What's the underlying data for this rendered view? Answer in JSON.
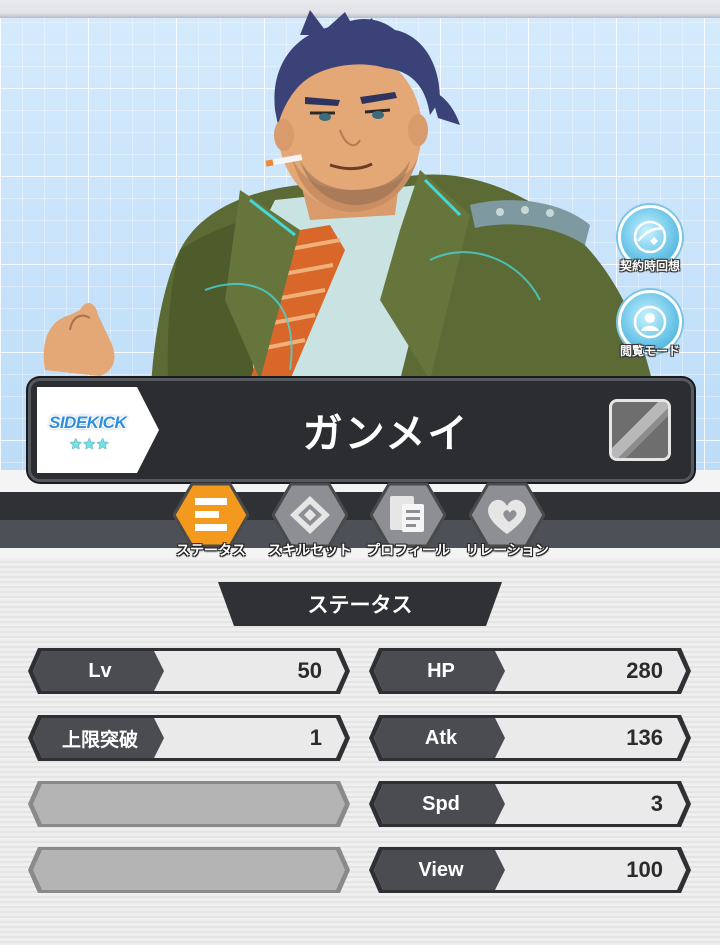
{
  "character": {
    "name": "ガンメイ",
    "rank": "SIDEKICK",
    "stars": "★★★"
  },
  "side_buttons": [
    {
      "label": "契約時回想",
      "icon": "memory-icon"
    },
    {
      "label": "閲覧モード",
      "icon": "view-mode-icon"
    }
  ],
  "tabs": [
    {
      "label": "ステータス",
      "icon": "status-icon",
      "active": true
    },
    {
      "label": "スキルセット",
      "icon": "skill-icon",
      "active": false
    },
    {
      "label": "プロフィール",
      "icon": "profile-icon",
      "active": false
    },
    {
      "label": "リレーション",
      "icon": "relation-icon",
      "active": false
    }
  ],
  "section_title": "ステータス",
  "stats_left": [
    {
      "label": "Lv",
      "value": "50"
    },
    {
      "label": "上限突破",
      "value": "1"
    }
  ],
  "stats_right": [
    {
      "label": "HP",
      "value": "280"
    },
    {
      "label": "Atk",
      "value": "136"
    },
    {
      "label": "Spd",
      "value": "3"
    },
    {
      "label": "View",
      "value": "100"
    }
  ],
  "colors": {
    "accent_orange": "#f39a1e",
    "panel_dark": "#2b2d31",
    "stat_label_bg": "#4a4c52",
    "stat_value_bg": "#eaeaea",
    "hero_bg": "#cfe6fb"
  }
}
